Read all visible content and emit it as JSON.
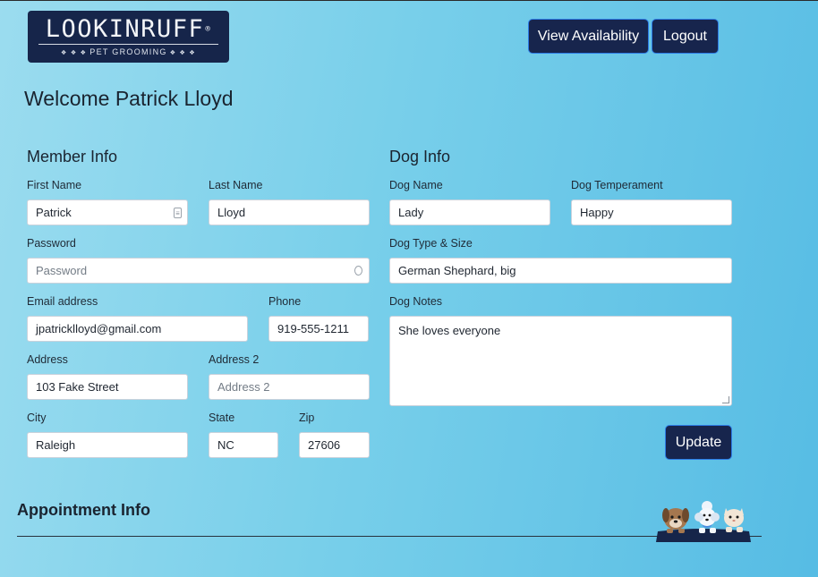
{
  "header": {
    "logo_text": "LOOKINRUFF",
    "logo_reg": "®",
    "logo_tagline": "PET GROOMING",
    "view_availability_label": "View Availability",
    "logout_label": "Logout"
  },
  "welcome": "Welcome Patrick Lloyd",
  "member": {
    "heading": "Member Info",
    "first_name_label": "First Name",
    "first_name": "Patrick",
    "last_name_label": "Last Name",
    "last_name": "Lloyd",
    "password_label": "Password",
    "password_placeholder": "Password",
    "email_label": "Email address",
    "email": "jpatricklloyd@gmail.com",
    "phone_label": "Phone",
    "phone": "919-555-1211",
    "address_label": "Address",
    "address": "103 Fake Street",
    "address2_label": "Address 2",
    "address2_placeholder": "Address 2",
    "city_label": "City",
    "city": "Raleigh",
    "state_label": "State",
    "state": "NC",
    "zip_label": "Zip",
    "zip": "27606"
  },
  "dog": {
    "heading": "Dog Info",
    "name_label": "Dog Name",
    "name": "Lady",
    "temperament_label": "Dog Temperament",
    "temperament": "Happy",
    "type_label": "Dog Type & Size",
    "type": "German Shephard, big",
    "notes_label": "Dog Notes",
    "notes": "She loves everyone",
    "update_label": "Update"
  },
  "appointment": {
    "heading": "Appointment Info"
  },
  "colors": {
    "navy": "#17254d",
    "button_border": "#2c7be5",
    "bg_left": "#9bdcef",
    "bg_right": "#56bce4"
  }
}
